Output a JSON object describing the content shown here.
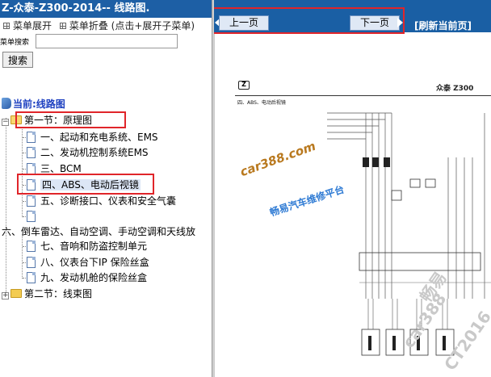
{
  "left_panel": {
    "title": "Z-众泰-Z300-2014-- 线路图.",
    "menu_expand": "菜单展开",
    "menu_collapse": "菜单折叠 (点击+展开子菜单)",
    "search_label": "菜单搜索",
    "search_value": "",
    "search_button": "搜索",
    "tree_root": "当前:线路图",
    "tree": {
      "section1": "第一节：原理图",
      "items": [
        "一、起动和充电系统、EMS",
        "二、发动机控制系统EMS",
        "三、BCM",
        "四、ABS、电动后视镜",
        "五、诊断接口、仪表和安全气囊",
        "",
        "六、倒车雷达、自动空调、手动空调和天线放",
        "七、音响和防盗控制单元",
        "八、仪表台下IP 保险丝盒",
        "九、发动机舱的保险丝盒"
      ],
      "section2": "第二节：线束图",
      "selected_index": 3
    }
  },
  "right_panel": {
    "prev_button": "上一页",
    "next_button": "下一页",
    "refresh_link": "[刷新当前页]",
    "document": {
      "brand_text": "众泰 Z300",
      "section_title": "四、ABS、电动后视镜",
      "watermark_site": "car388.com",
      "watermark_platform": "畅易汽车维修平台",
      "watermark_faint": [
        "畅易",
        "car388",
        "CT2016"
      ]
    }
  },
  "colors": {
    "title_bar": "#1d5fa5",
    "nav_bar": "#1a5fa4",
    "highlight_box": "#e0252a",
    "tree_link": "#1c3fc0"
  },
  "icons": [
    "menu-grid-icon",
    "book-icon",
    "folder-icon",
    "document-icon",
    "arrow-left-icon",
    "arrow-right-icon"
  ]
}
